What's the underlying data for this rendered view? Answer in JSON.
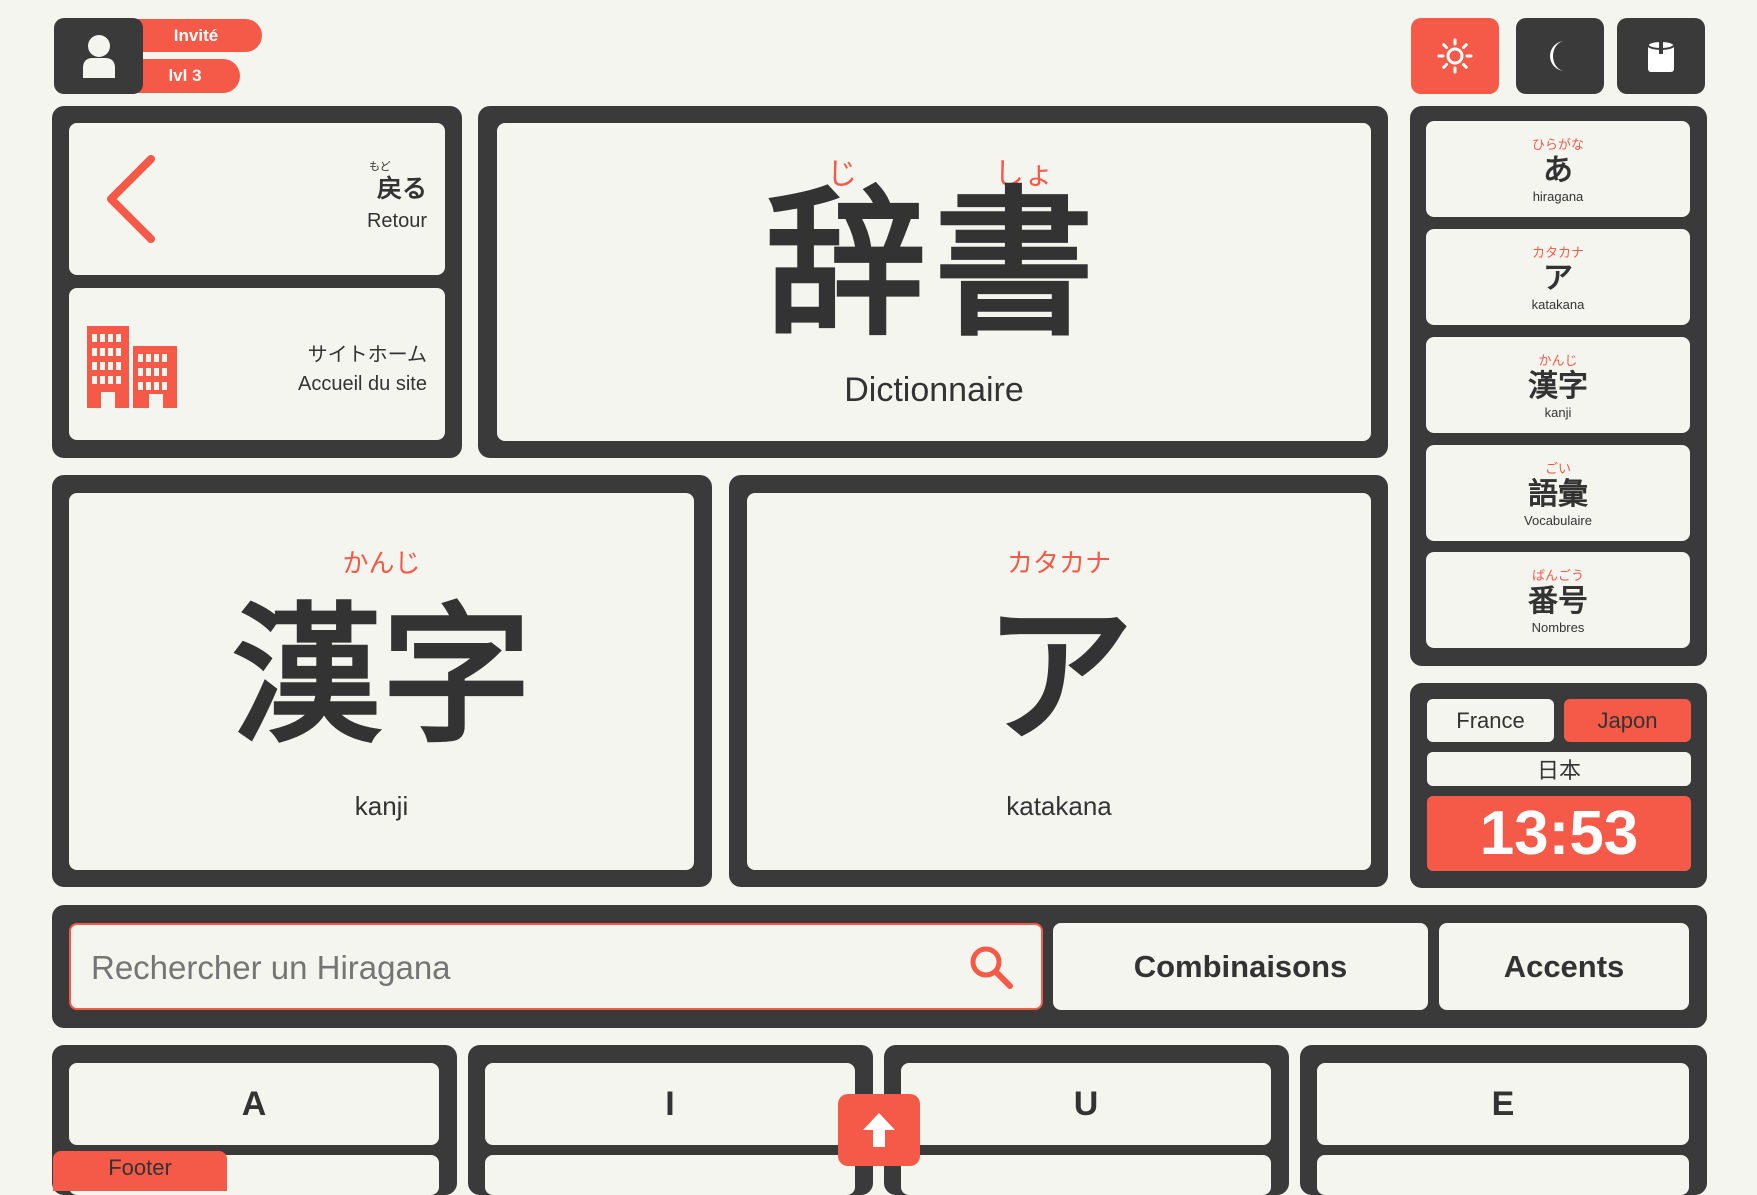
{
  "user": {
    "name": "Invité",
    "level": "lvl 3"
  },
  "theme_buttons": {
    "light": "sun-icon",
    "dark": "moon-icon",
    "paint": "paint-bucket-icon"
  },
  "nav": {
    "back": {
      "furigana": "もど",
      "kanji": "戻る",
      "label": "Retour"
    },
    "home": {
      "jp": "サイトホーム",
      "label": "Accueil du site"
    }
  },
  "dictionary": {
    "furigana_1": "じ",
    "furigana_2": "しょ",
    "kanji": "辞書",
    "label": "Dictionnaire"
  },
  "sidebar": {
    "items": [
      {
        "furigana": "ひらがな",
        "kana": "あ",
        "label": "hiragana"
      },
      {
        "furigana": "カタカナ",
        "kana": "ア",
        "label": "katakana"
      },
      {
        "furigana": "かんじ",
        "kana": "漢字",
        "label": "kanji"
      },
      {
        "furigana": "ごい",
        "kana": "語彙",
        "label": "Vocabulaire"
      },
      {
        "furigana": "ばんごう",
        "kana": "番号",
        "label": "Nombres"
      }
    ]
  },
  "kanji_card": {
    "furigana": "かんじ",
    "kanji": "漢字",
    "label": "kanji"
  },
  "katakana_card": {
    "furigana": "カタカナ",
    "kana": "ア",
    "label": "katakana"
  },
  "clock": {
    "tab_france": "France",
    "tab_japan": "Japon",
    "location": "日本",
    "time": "13:53"
  },
  "search": {
    "placeholder": "Rechercher un Hiragana",
    "combinations": "Combinaisons",
    "accents": "Accents"
  },
  "columns": [
    "A",
    "I",
    "U",
    "E"
  ],
  "footer": {
    "label": "Footer"
  },
  "colors": {
    "accent": "#f45a47",
    "dark": "#3a3a3a",
    "background": "#f5f5f0"
  }
}
